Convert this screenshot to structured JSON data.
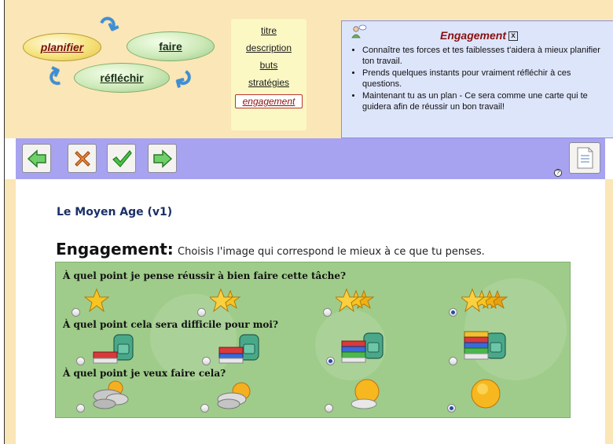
{
  "cycle": {
    "planifier": "planifier",
    "faire": "faire",
    "reflechir": "réfléchir"
  },
  "nav": {
    "titre": "titre",
    "description": "description",
    "buts": "buts",
    "strategies": "stratégies",
    "engagement": "engagement"
  },
  "info": {
    "title": "Engagement",
    "close": "x",
    "bullets": [
      "Connaître tes forces et tes faiblesses t'aidera à mieux planifier ton travail.",
      "Prends quelques instants pour vraiment réfléchir à ces questions.",
      "Maintenant tu as un plan - Ce sera comme une carte qui te guidera afin de réussir un bon travail!"
    ]
  },
  "toolbar": {
    "prev_icon": "arrow-left-icon",
    "cancel_icon": "x-icon",
    "ok_icon": "checkmark-icon",
    "next_icon": "arrow-right-icon",
    "doc_icon": "document-icon",
    "help": "?"
  },
  "main": {
    "doc_title": "Le Moyen Age (v1)",
    "heading": "Engagement:",
    "instruction": "Choisis l'image qui correspond le mieux à ce que tu penses."
  },
  "questions": [
    {
      "text": "À quel point je pense réussir à bien faire cette tâche?",
      "icon": "stars-icon",
      "options": [
        1,
        2,
        3,
        4
      ],
      "selected_index": 3
    },
    {
      "text": "À quel point cela sera difficile pour moi?",
      "icon": "books-backpack-icon",
      "options": [
        1,
        2,
        3,
        4
      ],
      "selected_index": 2
    },
    {
      "text": "À quel point je veux faire cela?",
      "icon": "weather-icon",
      "options": [
        "cloudy",
        "partly-cloudy",
        "mostly-sunny",
        "sunny"
      ],
      "selected_index": 3
    }
  ],
  "colors": {
    "header_bg": "#fbe6b7",
    "toolbar_bg": "#a7a3f0",
    "panel_bg": "#9fcc8a",
    "info_bg": "#dde5fb",
    "accent_red": "#8a1010",
    "radio_selected": "#1f4fa8"
  }
}
